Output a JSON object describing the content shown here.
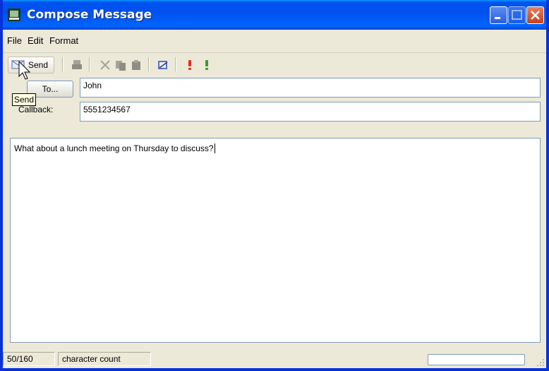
{
  "window": {
    "title": "Compose Message"
  },
  "menu": {
    "file": "File",
    "edit": "Edit",
    "format": "Format"
  },
  "toolbar": {
    "send_label": "Send",
    "icons": [
      "envelope-send-icon",
      "print-icon",
      "cut-icon",
      "copy-icon",
      "paste-icon",
      "address-book-icon",
      "high-priority-icon",
      "low-priority-icon"
    ],
    "priority_high_color": "#e0301e",
    "priority_low_color": "#2fa02f"
  },
  "tooltip": {
    "text": "Send"
  },
  "form": {
    "to_button_label": "To...",
    "to_value": "John",
    "callback_label": "Callback:",
    "callback_value": "5551234567"
  },
  "message": {
    "body": "What about a lunch meeting on Thursday to discuss?"
  },
  "status": {
    "count": "50/160",
    "count_label": "character count"
  },
  "colors": {
    "titlebar": "#0050ee",
    "window_bg": "#ece9d8",
    "border": "#0831d9"
  }
}
